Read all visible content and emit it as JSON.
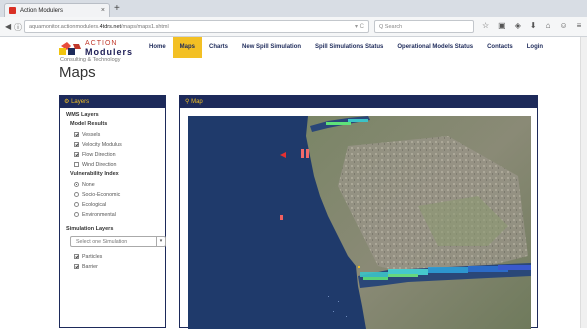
{
  "browser": {
    "tab_title": "Action Modulers",
    "tab_close": "×",
    "new_tab": "+",
    "url_prefix": "aquamonitor.actionmodulers.",
    "url_host": "4tdrs.net",
    "url_path": "/maps/maps1.shtml",
    "url_right": "▾ C",
    "search_placeholder": "Q Search"
  },
  "logo": {
    "brand_top": "ACTION",
    "brand_main": "Modulers",
    "tagline": "Consulting & Technology"
  },
  "page_title": "Maps",
  "menu": [
    {
      "label": "Home",
      "active": false
    },
    {
      "label": "Maps",
      "active": true
    },
    {
      "label": "Charts",
      "active": false
    },
    {
      "label": "New Spill Simulation",
      "active": false
    },
    {
      "label": "Spill Simulations Status",
      "active": false
    },
    {
      "label": "Operational Models Status",
      "active": false
    },
    {
      "label": "Contacts",
      "active": false
    },
    {
      "label": "Login",
      "active": false
    }
  ],
  "layers_panel": {
    "title": "Layers",
    "wms_title": "WMS Layers",
    "model_results_title": "Model Results",
    "model_results": [
      {
        "label": "Vessels",
        "checked": true
      },
      {
        "label": "Velocity Modulus",
        "checked": true
      },
      {
        "label": "Flow Direction",
        "checked": true
      },
      {
        "label": "Wind Direction",
        "checked": false
      }
    ],
    "vulnerability_title": "Vulnerability Index",
    "vulnerability": [
      {
        "label": "None",
        "selected": true
      },
      {
        "label": "Socio-Economic",
        "selected": false
      },
      {
        "label": "Ecological",
        "selected": false
      },
      {
        "label": "Environmental",
        "selected": false
      }
    ],
    "simulation_title": "Simulation Layers",
    "simulation_select": "Select one Simulation",
    "simulation_layers": [
      {
        "label": "Particles",
        "checked": true
      },
      {
        "label": "Barrier",
        "checked": true
      }
    ]
  },
  "map_panel": {
    "title": "Map"
  },
  "colors": {
    "navy": "#1d2a5a",
    "accent": "#f3c024",
    "ocean": "#1f3a6b"
  }
}
